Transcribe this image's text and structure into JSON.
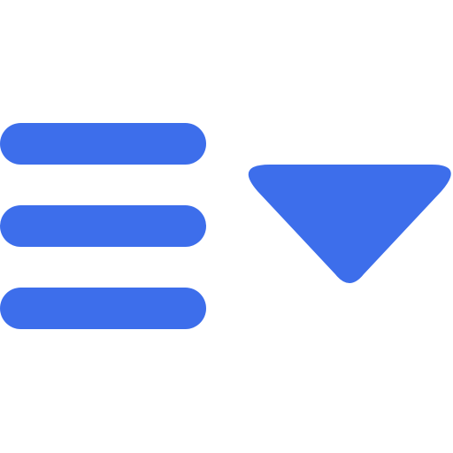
{
  "icon": {
    "name": "menu-dropdown-icon",
    "parts": [
      "hamburger-lines-icon",
      "caret-down-icon"
    ],
    "color": "#3D6EEB",
    "background": "#FFFFFF"
  }
}
